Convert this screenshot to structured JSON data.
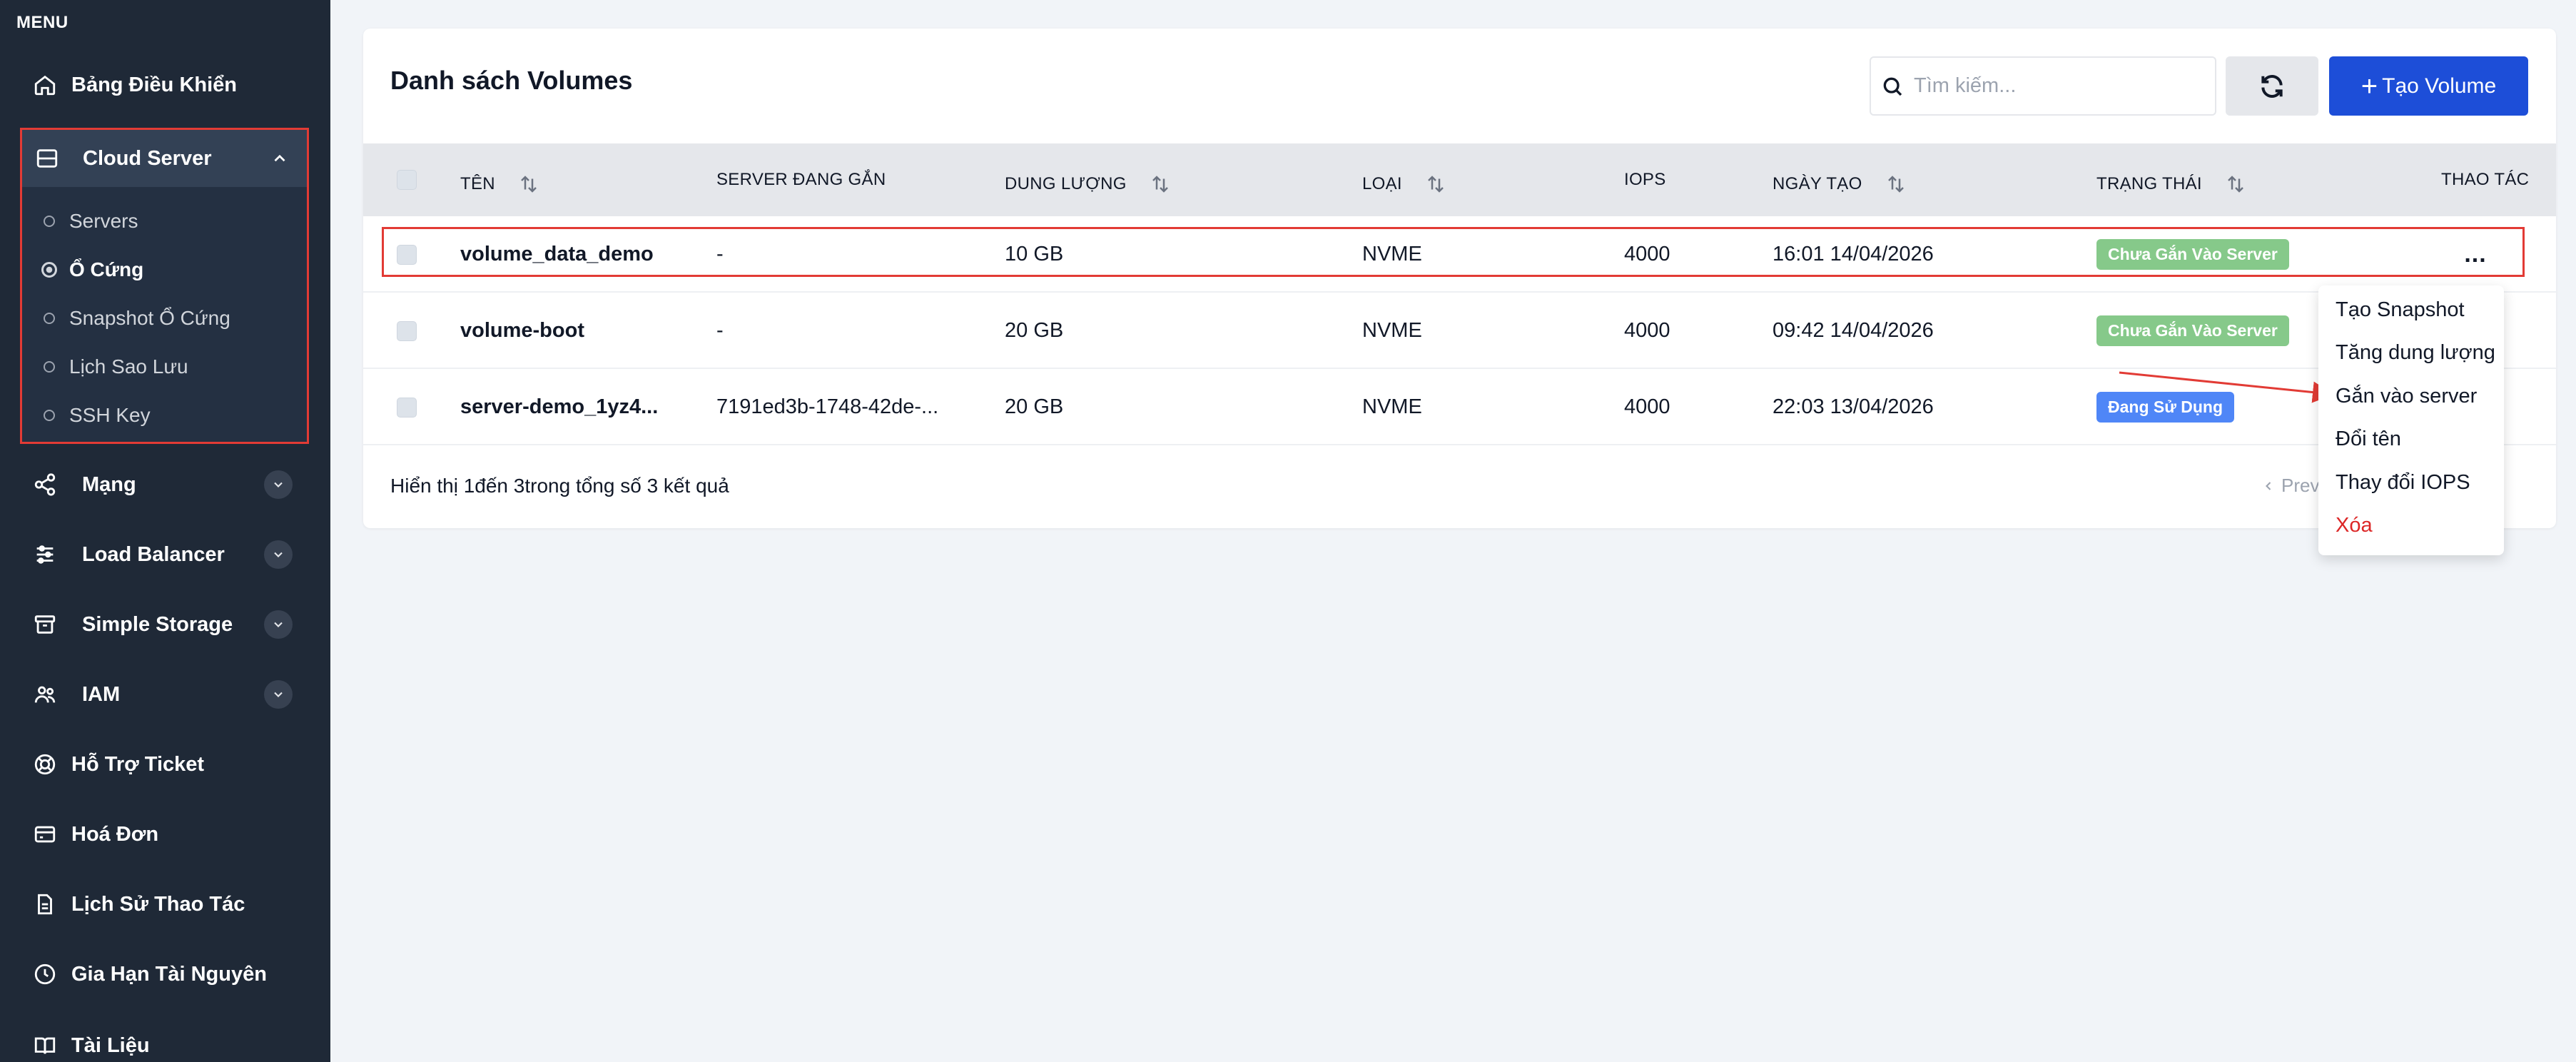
{
  "sidebar": {
    "menu_label": "MENU",
    "items": [
      {
        "label": "Bảng Điều Khiển",
        "icon": "home-icon"
      },
      {
        "label": "Cloud Server",
        "icon": "server-icon"
      },
      {
        "label": "Mạng",
        "icon": "share-icon"
      },
      {
        "label": "Load Balancer",
        "icon": "sliders-icon"
      },
      {
        "label": "Simple Storage",
        "icon": "archive-icon"
      },
      {
        "label": "IAM",
        "icon": "users-icon"
      },
      {
        "label": "Hỗ Trợ Ticket",
        "icon": "lifebuoy-icon"
      },
      {
        "label": "Hoá Đơn",
        "icon": "credit-card-icon"
      },
      {
        "label": "Lịch Sử Thao Tác",
        "icon": "file-icon"
      },
      {
        "label": "Gia Hạn Tài Nguyên",
        "icon": "clock-icon"
      },
      {
        "label": "Tài Liệu",
        "icon": "book-icon"
      }
    ],
    "cloud_sub": [
      {
        "label": "Servers"
      },
      {
        "label": "Ổ Cứng",
        "active": true
      },
      {
        "label": "Snapshot Ổ Cứng"
      },
      {
        "label": "Lịch Sao Lưu"
      },
      {
        "label": "SSH Key"
      }
    ]
  },
  "main": {
    "title": "Danh sách Volumes",
    "search_placeholder": "Tìm kiếm...",
    "create_label": "Tạo Volume",
    "columns": [
      "TÊN",
      "SERVER ĐANG GẮN",
      "DUNG LƯỢNG",
      "LOẠI",
      "IOPS",
      "NGÀY TẠO",
      "TRẠNG THÁI",
      "THAO TÁC"
    ],
    "rows": [
      {
        "name": "volume_data_demo",
        "server": "-",
        "size": "10 GB",
        "type": "NVME",
        "iops": "4000",
        "created": "16:01 14/04/2026",
        "status": "Chưa Gắn Vào Server"
      },
      {
        "name": "volume-boot",
        "server": "-",
        "size": "20 GB",
        "type": "NVME",
        "iops": "4000",
        "created": "09:42 14/04/2026",
        "status": "Chưa Gắn Vào Server"
      },
      {
        "name": "server-demo_1yz4...",
        "server": "7191ed3b-1748-42de-...",
        "size": "20 GB",
        "type": "NVME",
        "iops": "4000",
        "created": "22:03 13/04/2026",
        "status": "Đang Sử Dụng"
      }
    ],
    "more_label": "...",
    "footer": "Hiển thị 1đến 3trong tổng số 3 kết quả",
    "prev_label": "Previ"
  },
  "dropdown": {
    "items": [
      "Tạo Snapshot",
      "Tăng dung lượng",
      "Gắn vào server",
      "Đổi tên",
      "Thay đổi IOPS",
      "Xóa"
    ]
  },
  "colors": {
    "sidebar_bg": "#1f2937",
    "accent": "#1d4ed8",
    "status_unattached": "#86c98a",
    "status_in_use": "#4f86f7",
    "highlight": "#e23b35",
    "danger": "#dc2626"
  }
}
